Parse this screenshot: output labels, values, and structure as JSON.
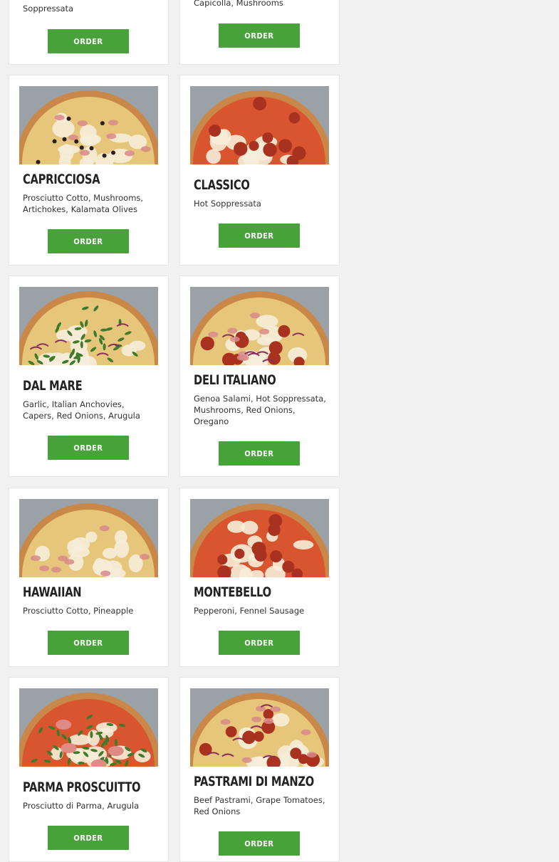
{
  "menu": {
    "order_label": "ORDER",
    "items": [
      {
        "name": "",
        "desc": "Soppressata"
      },
      {
        "name": "",
        "desc": "Capicolla, Mushrooms"
      },
      {
        "name": "Capricciosa",
        "desc": "Prosciutto Cotto, Mushrooms, Artichokes, Kalamata Olives"
      },
      {
        "name": "Classico",
        "desc": "Hot Soppressata"
      },
      {
        "name": "Dal Mare",
        "desc": "Garlic, Italian Anchovies, Capers, Red Onions, Arugula"
      },
      {
        "name": "Deli Italiano",
        "desc": "Genoa Salami, Hot Soppressata, Mushrooms, Red Onions, Oregano"
      },
      {
        "name": "Hawaiian",
        "desc": "Prosciutto Cotto, Pineapple"
      },
      {
        "name": "Montebello",
        "desc": "Pepperoni, Fennel Sausage"
      },
      {
        "name": "Parma Proscuitto",
        "desc": "Prosciutto di Parma, Arugula"
      },
      {
        "name": "Pastrami di Manzo",
        "desc": "Beef Pastrami, Grape Tomatoes, Red Onions"
      }
    ]
  },
  "colors": {
    "order_button": "#47a23a",
    "background": "#f1f1f1",
    "card": "#ffffff"
  }
}
